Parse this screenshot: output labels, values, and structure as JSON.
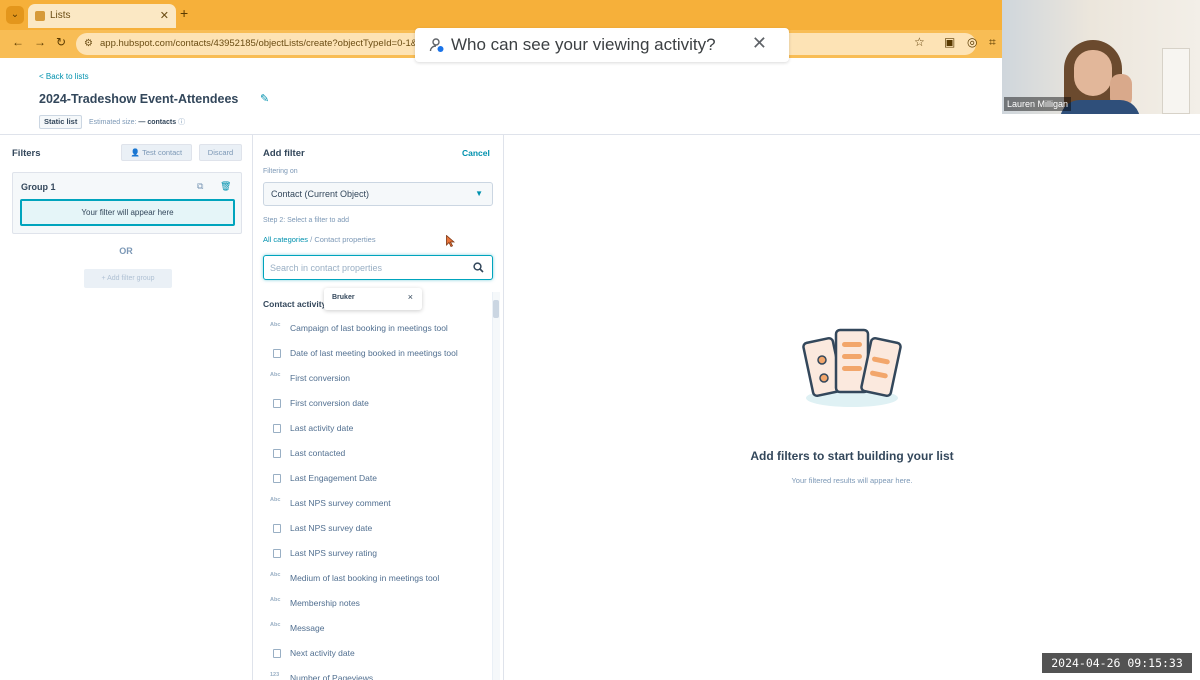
{
  "browser": {
    "tab_title": "Lists",
    "new_tab": "+",
    "url": "app.hubspot.com/contacts/43952185/objectLists/create?objectTypeId=0-1&pres",
    "popup_text": "Who can see your viewing activity?"
  },
  "webcam": {
    "name": "Lauren Milligan"
  },
  "header": {
    "back": "< Back to lists",
    "title": "2024-Tradeshow Event-Attendees",
    "tag": "Static list",
    "estimated_label": "Estimated size:",
    "estimated_value": "— contacts"
  },
  "filters": {
    "heading": "Filters",
    "test_contact": "Test contact",
    "discard": "Discard",
    "group_label": "Group 1",
    "placeholder": "Your filter will appear here",
    "or": "OR",
    "add_group": "+ Add filter group"
  },
  "add_filter": {
    "heading": "Add filter",
    "cancel": "Cancel",
    "filtering_on": "Filtering on",
    "object": "Contact (Current Object)",
    "step2": "Step 2: Select a filter to add",
    "all_categories": "All categories",
    "crumb_sep": "/",
    "crumb_current": "Contact properties",
    "search_placeholder": "Search in contact properties",
    "section": "Contact activity",
    "tooltip": "Bruker",
    "tooltip_close": "×",
    "properties": [
      {
        "label": "Campaign of last booking in meetings tool",
        "icon": "text-icon"
      },
      {
        "label": "Date of last meeting booked in meetings tool",
        "icon": "calendar-icon"
      },
      {
        "label": "First conversion",
        "icon": "text-icon"
      },
      {
        "label": "First conversion date",
        "icon": "calendar-icon"
      },
      {
        "label": "Last activity date",
        "icon": "calendar-icon"
      },
      {
        "label": "Last contacted",
        "icon": "calendar-icon"
      },
      {
        "label": "Last Engagement Date",
        "icon": "calendar-icon"
      },
      {
        "label": "Last NPS survey comment",
        "icon": "text-icon"
      },
      {
        "label": "Last NPS survey date",
        "icon": "calendar-icon"
      },
      {
        "label": "Last NPS survey rating",
        "icon": "list-icon"
      },
      {
        "label": "Medium of last booking in meetings tool",
        "icon": "text-icon"
      },
      {
        "label": "Membership notes",
        "icon": "text-icon"
      },
      {
        "label": "Message",
        "icon": "text-icon"
      },
      {
        "label": "Next activity date",
        "icon": "calendar-icon"
      },
      {
        "label": "Number of Pageviews",
        "icon": "number-icon"
      }
    ]
  },
  "empty_state": {
    "heading": "Add filters to start building your list",
    "sub": "Your filtered results will appear here."
  },
  "timestamp": "2024-04-26 09:15:33"
}
